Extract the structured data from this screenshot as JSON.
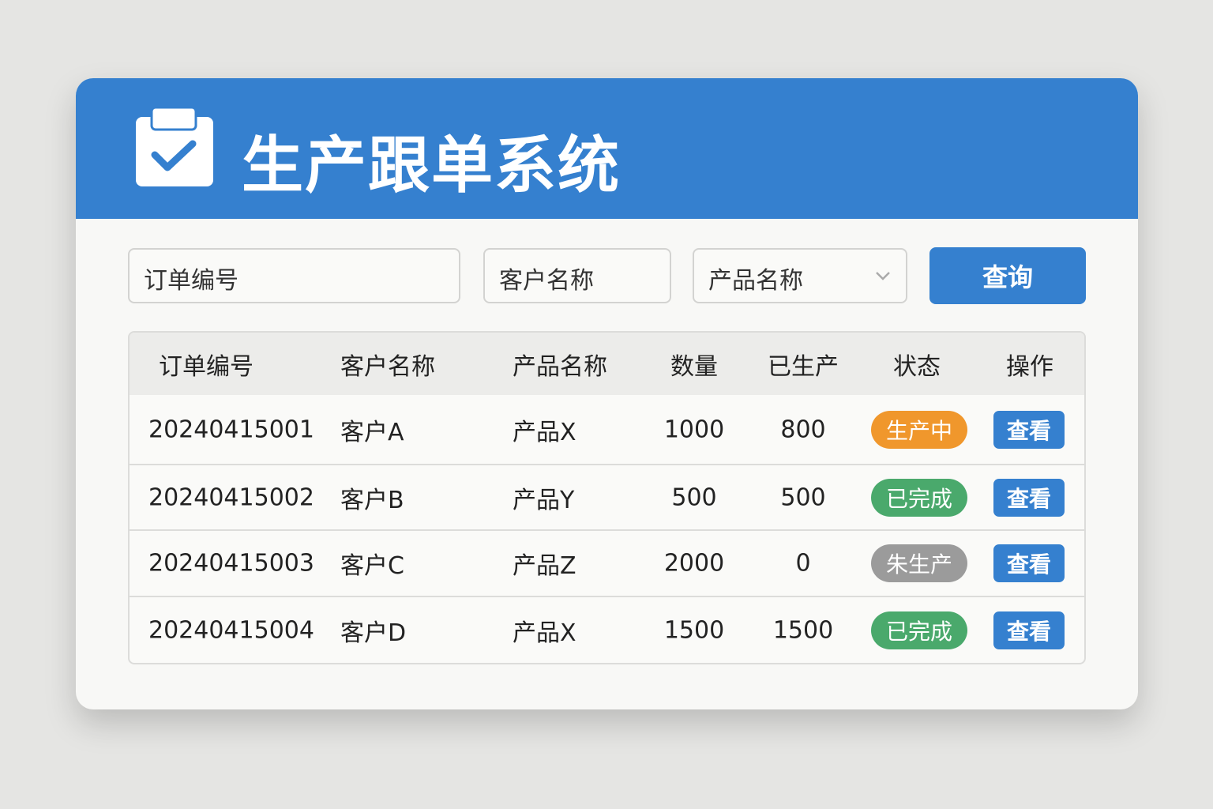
{
  "app": {
    "title": "生产跟单系统"
  },
  "filters": {
    "order_no": "订单编号",
    "customer": "客户名称",
    "product": "产品名称",
    "query_label": "查询"
  },
  "table": {
    "headers": [
      "订单编号",
      "客户名称",
      "产品名称",
      "数量",
      "已生产",
      "状态",
      "操作"
    ],
    "rows": [
      {
        "order": "20240415001",
        "customer": "客户A",
        "product": "产品X",
        "qty": "1000",
        "done": "800",
        "status": "生产中",
        "status_color": "#f0972c",
        "action": "查看"
      },
      {
        "order": "20240415002",
        "customer": "客户B",
        "product": "产品Y",
        "qty": "500",
        "done": "500",
        "status": "已完成",
        "status_color": "#4aa96c",
        "action": "查看"
      },
      {
        "order": "20240415003",
        "customer": "客户C",
        "product": "产品Z",
        "qty": "2000",
        "done": "0",
        "status": "朱生产",
        "status_color": "#9b9b9b",
        "action": "查看"
      },
      {
        "order": "20240415004",
        "customer": "客户D",
        "product": "产品X",
        "qty": "1500",
        "done": "1500",
        "status": "已完成",
        "status_color": "#4aa96c",
        "action": "查看"
      }
    ]
  }
}
